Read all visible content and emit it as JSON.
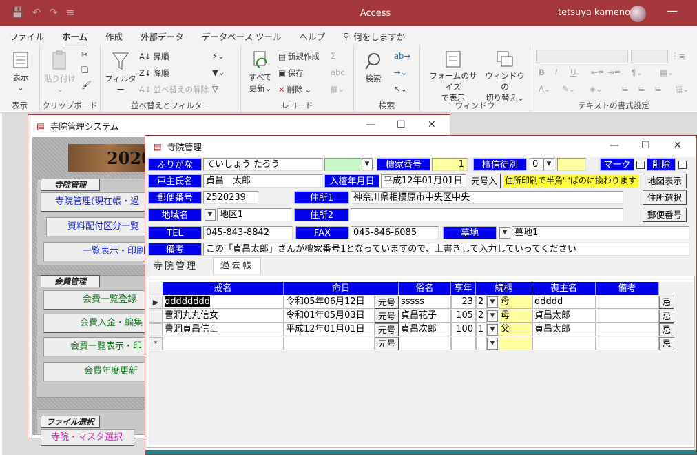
{
  "titlebar": {
    "app_name": "Access",
    "user_name": "tetsuya kameno"
  },
  "ribbon_tabs": [
    "ファイル",
    "ホーム",
    "作成",
    "外部データ",
    "データベース ツール",
    "ヘルプ"
  ],
  "tell_me": "何をしますか",
  "ribbon": {
    "view": {
      "label": "表示",
      "group": "表示"
    },
    "clipboard": {
      "paste": "貼り付け",
      "group": "クリップボード"
    },
    "sort": {
      "filter": "フィルター",
      "asc": "昇順",
      "desc": "降順",
      "clear": "並べ替えの解除",
      "group": "並べ替えとフィルター"
    },
    "records": {
      "refresh_all_1": "すべて",
      "refresh_all_2": "更新",
      "new": "新規作成",
      "save": "保存",
      "delete": "削除",
      "group": "レコード"
    },
    "find": {
      "find": "検索",
      "group": "検索"
    },
    "window": {
      "fit_1": "フォームのサイズ",
      "fit_2": "で表示",
      "switch_1": "ウィンドウの",
      "switch_2": "切り替え",
      "group": "ウィンドウ"
    },
    "text_format": {
      "group": "テキストの書式設定"
    }
  },
  "bg_window": {
    "title": "寺院管理システム",
    "banner": "2020",
    "sections": [
      {
        "header": "寺院管理",
        "buttons": [
          "寺院管理(現在帳・過",
          "資料配付区分一覧",
          "一覧表示・印刷"
        ]
      },
      {
        "header": "会費管理",
        "buttons": [
          "会費一覧登録",
          "会費入金・編集",
          "会費一覧表示・印",
          "会費年度更新"
        ]
      },
      {
        "header": "ファイル選択",
        "buttons": [
          "寺院・マスタ選択"
        ]
      }
    ]
  },
  "fg_window": {
    "title": "寺院管理",
    "labels": {
      "furigana": "ふりがな",
      "dankabango": "檀家番号",
      "danshin": "檀信徒別",
      "mark": "マーク",
      "delete": "削除",
      "koshu": "戸主氏名",
      "nyudan": "入檀年月日",
      "yubin": "郵便番号",
      "jusho1": "住所1",
      "chiiki": "地域名",
      "jusho2": "住所2",
      "tel": "TEL",
      "fax": "FAX",
      "bochi": "墓地",
      "biko": "備考"
    },
    "values": {
      "furigana": "ていしょう たろう",
      "dankabango": "1",
      "danshin": "0",
      "koshu": "貞昌　太郎",
      "nyudan": "平成12年01月01日",
      "yubin": "2520239",
      "jusho1": "神奈川県相模原市中央区中央",
      "chiiki": "地区1",
      "jusho2": "",
      "tel": "045-843-8842",
      "fax": "045-846-6085",
      "bochi": "墓地1",
      "biko": "この「貞昌太郎」さんが檀家番号1となっていますので、上書きして入力していってください"
    },
    "note": "住所印刷で半角'-'ばのに換わります",
    "buttons": {
      "gengo": "元号入",
      "map": "地図表示",
      "address_select": "住所選択",
      "postal": "郵便番号"
    },
    "tabs": [
      "寺院管理",
      "過去帳"
    ],
    "grid": {
      "columns": [
        "戒名",
        "命日",
        "俗名",
        "享年",
        "続柄",
        "喪主名",
        "備考"
      ],
      "gengo_label": "元号",
      "imi_label": "忌",
      "rows": [
        {
          "kaimyo": "dddddddd",
          "meinichi": "令和05年06月12日",
          "zokumyo": "sssss",
          "kyonen": "23",
          "code": "2",
          "zokugara": "母",
          "moshu": "ddddd",
          "biko": ""
        },
        {
          "kaimyo": "曹洞丸丸信女",
          "meinichi": "令和01年05月03日",
          "zokumyo": "貞昌花子",
          "kyonen": "105",
          "code": "2",
          "zokugara": "母",
          "moshu": "貞昌太郎",
          "biko": ""
        },
        {
          "kaimyo": "曹洞貞昌信士",
          "meinichi": "平成12年01月01日",
          "zokumyo": "貞昌次郎",
          "kyonen": "100",
          "code": "1",
          "zokugara": "父",
          "moshu": "貞昌太郎",
          "biko": ""
        }
      ]
    }
  }
}
